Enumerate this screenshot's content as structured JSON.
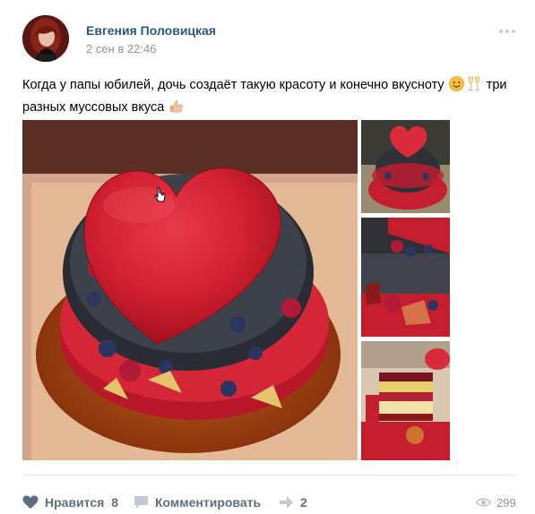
{
  "post": {
    "author": "Евгения Половицкая",
    "date": "2 сен в 22:46",
    "text_part1": "Когда у папы юбилей, дочь создаёт такую красоту и конечно вкусноту",
    "text_part2": "три",
    "text_part3": "разных муссовых вкуса",
    "emojis": [
      "smiling-face-emoji",
      "champagne-glasses-emoji",
      "thumbs-up-emoji"
    ]
  },
  "photos": {
    "main": "heart-cake-photo",
    "thumbs": [
      "cake-top-view-thumb",
      "cake-side-closeup-thumb",
      "cake-slice-thumb"
    ]
  },
  "footer": {
    "like_label": "Нравится",
    "like_count": "8",
    "comment_label": "Комментировать",
    "share_count": "2",
    "views_count": "299",
    "icons": [
      "heart-icon",
      "comment-icon",
      "share-icon",
      "eye-icon"
    ]
  },
  "colors": {
    "link": "#2a5885",
    "action": "#5e6d80",
    "muted": "#939393",
    "like_heart": "#5e6d80"
  }
}
